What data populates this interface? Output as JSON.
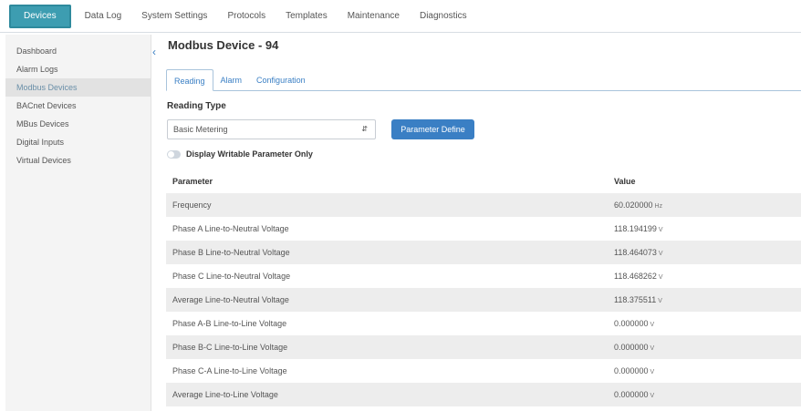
{
  "topnav": {
    "tabs": [
      {
        "label": "Devices",
        "active": true
      },
      {
        "label": "Data Log"
      },
      {
        "label": "System Settings"
      },
      {
        "label": "Protocols"
      },
      {
        "label": "Templates"
      },
      {
        "label": "Maintenance"
      },
      {
        "label": "Diagnostics"
      }
    ]
  },
  "sidebar": {
    "items": [
      {
        "label": "Dashboard"
      },
      {
        "label": "Alarm Logs"
      },
      {
        "label": "Modbus Devices",
        "active": true
      },
      {
        "label": "BACnet Devices"
      },
      {
        "label": "MBus Devices"
      },
      {
        "label": "Digital Inputs"
      },
      {
        "label": "Virtual Devices"
      }
    ]
  },
  "main": {
    "title": "Modbus Device - 94",
    "subtabs": [
      {
        "label": "Reading",
        "active": true
      },
      {
        "label": "Alarm"
      },
      {
        "label": "Configuration"
      }
    ],
    "reading_type_label": "Reading Type",
    "reading_type_value": "Basic Metering",
    "parameter_define_label": "Parameter Define",
    "toggle_label": "Display Writable Parameter Only",
    "table": {
      "headers": [
        "Parameter",
        "Value"
      ],
      "rows": [
        {
          "parameter": "Frequency",
          "value": "60.020000",
          "unit": "Hz"
        },
        {
          "parameter": "Phase A Line-to-Neutral Voltage",
          "value": "118.194199",
          "unit": "V"
        },
        {
          "parameter": "Phase B Line-to-Neutral Voltage",
          "value": "118.464073",
          "unit": "V"
        },
        {
          "parameter": "Phase C Line-to-Neutral Voltage",
          "value": "118.468262",
          "unit": "V"
        },
        {
          "parameter": "Average Line-to-Neutral Voltage",
          "value": "118.375511",
          "unit": "V"
        },
        {
          "parameter": "Phase A-B Line-to-Line Voltage",
          "value": "0.000000",
          "unit": "V"
        },
        {
          "parameter": "Phase B-C Line-to-Line Voltage",
          "value": "0.000000",
          "unit": "V"
        },
        {
          "parameter": "Phase C-A Line-to-Line Voltage",
          "value": "0.000000",
          "unit": "V"
        },
        {
          "parameter": "Average Line-to-Line Voltage",
          "value": "0.000000",
          "unit": "V"
        }
      ]
    }
  },
  "colors": {
    "active_tab": "#3d9db1",
    "accent_blue": "#3a7fc4",
    "row_alt": "#ededed"
  },
  "icons": {
    "collapse": "chevron-left-icon",
    "select": "chevron-updown-icon"
  }
}
